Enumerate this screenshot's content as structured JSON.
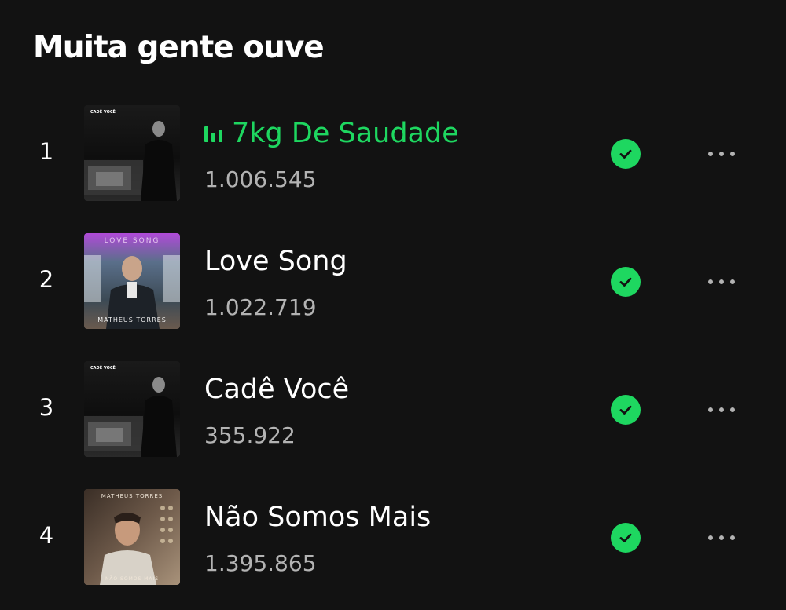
{
  "section": {
    "title": "Muita gente ouve"
  },
  "colors": {
    "background": "#121212",
    "accent_green": "#1ed760",
    "text_primary": "#ffffff",
    "text_secondary": "#b3b3b3"
  },
  "tracks": [
    {
      "rank": "1",
      "title": "7kg De Saudade",
      "plays": "1.006.545",
      "now_playing": true,
      "saved": true,
      "cover_text": "CADÊ VOCÊ"
    },
    {
      "rank": "2",
      "title": "Love Song",
      "plays": "1.022.719",
      "now_playing": false,
      "saved": true,
      "cover_text": "LOVE SONG",
      "cover_text_2": "MATHEUS TORRES"
    },
    {
      "rank": "3",
      "title": "Cadê Você",
      "plays": "355.922",
      "now_playing": false,
      "saved": true,
      "cover_text": "CADÊ VOCÊ"
    },
    {
      "rank": "4",
      "title": "Não Somos Mais",
      "plays": "1.395.865",
      "now_playing": false,
      "saved": true,
      "cover_text": "MATHEUS TORRES",
      "cover_text_2": "NÃO SOMOS MAIS"
    }
  ],
  "icons": {
    "now_playing": "equalizer-icon",
    "saved": "check-circle-icon",
    "more": "more-options-icon"
  }
}
